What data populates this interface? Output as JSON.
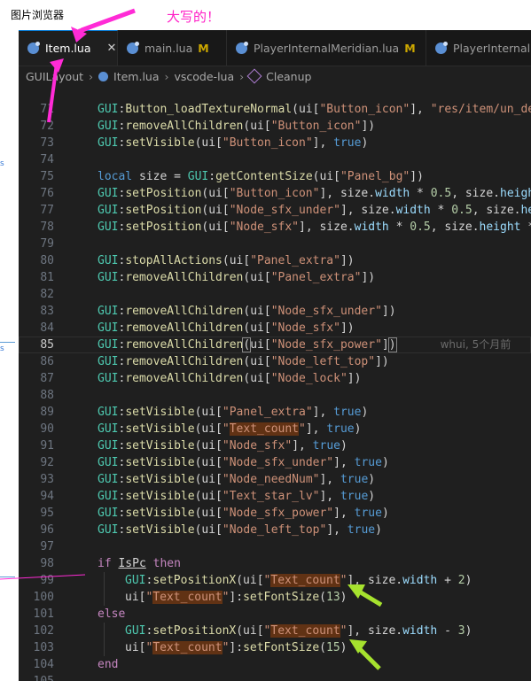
{
  "host": {
    "title": "图片浏览器",
    "note": "大写的！"
  },
  "tabs": [
    {
      "label": "Item.lua",
      "active": true,
      "modified": "",
      "close": "✕"
    },
    {
      "label": "main.lua",
      "active": false,
      "modified": "M"
    },
    {
      "label": "PlayerInternalMeridian.lua",
      "active": false,
      "modified": "M"
    },
    {
      "label": "PlayerInternalM",
      "active": false,
      "modified": ""
    }
  ],
  "breadcrumb": {
    "items": [
      "GUILayout",
      "Item.lua",
      "vscode-lua",
      "Cleanup"
    ]
  },
  "blame": "whui, 5个月前",
  "lines": [
    {
      "n": "71",
      "segs": [
        [
          "GUI",
          "glob"
        ],
        [
          ":",
          ""
        ],
        [
          "Button_loadTextureNormal",
          "fn"
        ],
        [
          "(ui[",
          ""
        ],
        [
          "\"Button_icon\"",
          "str"
        ],
        [
          "], ",
          ""
        ],
        [
          "\"res/item/un_def",
          "str"
        ]
      ]
    },
    {
      "n": "72",
      "segs": [
        [
          "GUI",
          "glob"
        ],
        [
          ":",
          ""
        ],
        [
          "removeAllChildren",
          "fn"
        ],
        [
          "(ui[",
          ""
        ],
        [
          "\"Button_icon\"",
          "str"
        ],
        [
          "])",
          ""
        ]
      ]
    },
    {
      "n": "73",
      "segs": [
        [
          "GUI",
          "glob"
        ],
        [
          ":",
          ""
        ],
        [
          "setVisible",
          "fn"
        ],
        [
          "(ui[",
          ""
        ],
        [
          "\"Button_icon\"",
          "str"
        ],
        [
          "], ",
          ""
        ],
        [
          "true",
          "kw"
        ],
        [
          ")",
          ""
        ]
      ]
    },
    {
      "n": "74",
      "segs": []
    },
    {
      "n": "75",
      "segs": [
        [
          "local ",
          "kw"
        ],
        [
          "size",
          ""
        ],
        [
          " = ",
          ""
        ],
        [
          "GUI",
          "glob"
        ],
        [
          ":",
          ""
        ],
        [
          "getContentSize",
          "fn"
        ],
        [
          "(ui[",
          ""
        ],
        [
          "\"Panel_bg\"",
          "str"
        ],
        [
          "])",
          ""
        ]
      ]
    },
    {
      "n": "76",
      "segs": [
        [
          "GUI",
          "glob"
        ],
        [
          ":",
          ""
        ],
        [
          "setPosition",
          "fn"
        ],
        [
          "(ui[",
          ""
        ],
        [
          "\"Button_icon\"",
          "str"
        ],
        [
          "], size.",
          ""
        ],
        [
          "width",
          "var"
        ],
        [
          " * ",
          ""
        ],
        [
          "0.5",
          "num"
        ],
        [
          ", size.",
          ""
        ],
        [
          "height",
          "var"
        ]
      ]
    },
    {
      "n": "77",
      "segs": [
        [
          "GUI",
          "glob"
        ],
        [
          ":",
          ""
        ],
        [
          "setPosition",
          "fn"
        ],
        [
          "(ui[",
          ""
        ],
        [
          "\"Node_sfx_under\"",
          "str"
        ],
        [
          "], size.",
          ""
        ],
        [
          "width",
          "var"
        ],
        [
          " * ",
          ""
        ],
        [
          "0.5",
          "num"
        ],
        [
          ", size.",
          ""
        ],
        [
          "hei",
          "var"
        ]
      ]
    },
    {
      "n": "78",
      "segs": [
        [
          "GUI",
          "glob"
        ],
        [
          ":",
          ""
        ],
        [
          "setPosition",
          "fn"
        ],
        [
          "(ui[",
          ""
        ],
        [
          "\"Node_sfx\"",
          "str"
        ],
        [
          "], size.",
          ""
        ],
        [
          "width",
          "var"
        ],
        [
          " * ",
          ""
        ],
        [
          "0.5",
          "num"
        ],
        [
          ", size.",
          ""
        ],
        [
          "height",
          "var"
        ],
        [
          " *",
          ""
        ]
      ]
    },
    {
      "n": "79",
      "segs": []
    },
    {
      "n": "80",
      "segs": [
        [
          "GUI",
          "glob"
        ],
        [
          ":",
          ""
        ],
        [
          "stopAllActions",
          "fn"
        ],
        [
          "(ui[",
          ""
        ],
        [
          "\"Panel_extra\"",
          "str"
        ],
        [
          "])",
          ""
        ]
      ]
    },
    {
      "n": "81",
      "segs": [
        [
          "GUI",
          "glob"
        ],
        [
          ":",
          ""
        ],
        [
          "removeAllChildren",
          "fn"
        ],
        [
          "(ui[",
          ""
        ],
        [
          "\"Panel_extra\"",
          "str"
        ],
        [
          "])",
          ""
        ]
      ]
    },
    {
      "n": "82",
      "segs": []
    },
    {
      "n": "83",
      "segs": [
        [
          "GUI",
          "glob"
        ],
        [
          ":",
          ""
        ],
        [
          "removeAllChildren",
          "fn"
        ],
        [
          "(ui[",
          ""
        ],
        [
          "\"Node_sfx_under\"",
          "str"
        ],
        [
          "])",
          ""
        ]
      ]
    },
    {
      "n": "84",
      "segs": [
        [
          "GUI",
          "glob"
        ],
        [
          ":",
          ""
        ],
        [
          "removeAllChildren",
          "fn"
        ],
        [
          "(ui[",
          ""
        ],
        [
          "\"Node_sfx\"",
          "str"
        ],
        [
          "])",
          ""
        ]
      ]
    },
    {
      "n": "85",
      "cur": true,
      "segs": [
        [
          "GUI",
          "glob"
        ],
        [
          ":",
          ""
        ],
        [
          "removeAllChildren",
          "fn"
        ],
        [
          "(",
          "bk"
        ],
        [
          "ui[",
          ""
        ],
        [
          "\"Node_sfx_power\"",
          "str"
        ],
        [
          "]",
          ""
        ],
        [
          ")",
          "bk"
        ]
      ]
    },
    {
      "n": "86",
      "segs": [
        [
          "GUI",
          "glob"
        ],
        [
          ":",
          ""
        ],
        [
          "removeAllChildren",
          "fn"
        ],
        [
          "(ui[",
          ""
        ],
        [
          "\"Node_left_top\"",
          "str"
        ],
        [
          "])",
          ""
        ]
      ]
    },
    {
      "n": "87",
      "segs": [
        [
          "GUI",
          "glob"
        ],
        [
          ":",
          ""
        ],
        [
          "removeAllChildren",
          "fn"
        ],
        [
          "(ui[",
          ""
        ],
        [
          "\"Node_lock\"",
          "str"
        ],
        [
          "])",
          ""
        ]
      ]
    },
    {
      "n": "88",
      "segs": []
    },
    {
      "n": "89",
      "segs": [
        [
          "GUI",
          "glob"
        ],
        [
          ":",
          ""
        ],
        [
          "setVisible",
          "fn"
        ],
        [
          "(ui[",
          ""
        ],
        [
          "\"Panel_extra\"",
          "str"
        ],
        [
          "], ",
          ""
        ],
        [
          "true",
          "kw"
        ],
        [
          ")",
          ""
        ]
      ]
    },
    {
      "n": "90",
      "segs": [
        [
          "GUI",
          "glob"
        ],
        [
          ":",
          ""
        ],
        [
          "setVisible",
          "fn"
        ],
        [
          "(ui[",
          ""
        ],
        [
          "\"",
          "str"
        ],
        [
          "Text_count",
          "hl"
        ],
        [
          "\"",
          "str"
        ],
        [
          "], ",
          ""
        ],
        [
          "true",
          "kw"
        ],
        [
          ")",
          ""
        ]
      ]
    },
    {
      "n": "91",
      "segs": [
        [
          "GUI",
          "glob"
        ],
        [
          ":",
          ""
        ],
        [
          "setVisible",
          "fn"
        ],
        [
          "(ui[",
          ""
        ],
        [
          "\"Node_sfx\"",
          "str"
        ],
        [
          "], ",
          ""
        ],
        [
          "true",
          "kw"
        ],
        [
          ")",
          ""
        ]
      ]
    },
    {
      "n": "92",
      "segs": [
        [
          "GUI",
          "glob"
        ],
        [
          ":",
          ""
        ],
        [
          "setVisible",
          "fn"
        ],
        [
          "(ui[",
          ""
        ],
        [
          "\"Node_sfx_under\"",
          "str"
        ],
        [
          "], ",
          ""
        ],
        [
          "true",
          "kw"
        ],
        [
          ")",
          ""
        ]
      ]
    },
    {
      "n": "93",
      "segs": [
        [
          "GUI",
          "glob"
        ],
        [
          ":",
          ""
        ],
        [
          "setVisible",
          "fn"
        ],
        [
          "(ui[",
          ""
        ],
        [
          "\"Node_needNum\"",
          "str"
        ],
        [
          "], ",
          ""
        ],
        [
          "true",
          "kw"
        ],
        [
          ")",
          ""
        ]
      ]
    },
    {
      "n": "94",
      "segs": [
        [
          "GUI",
          "glob"
        ],
        [
          ":",
          ""
        ],
        [
          "setVisible",
          "fn"
        ],
        [
          "(ui[",
          ""
        ],
        [
          "\"Text_star_lv\"",
          "str"
        ],
        [
          "], ",
          ""
        ],
        [
          "true",
          "kw"
        ],
        [
          ")",
          ""
        ]
      ]
    },
    {
      "n": "95",
      "segs": [
        [
          "GUI",
          "glob"
        ],
        [
          ":",
          ""
        ],
        [
          "setVisible",
          "fn"
        ],
        [
          "(ui[",
          ""
        ],
        [
          "\"Node_sfx_power\"",
          "str"
        ],
        [
          "], ",
          ""
        ],
        [
          "true",
          "kw"
        ],
        [
          ")",
          ""
        ]
      ]
    },
    {
      "n": "96",
      "segs": [
        [
          "GUI",
          "glob"
        ],
        [
          ":",
          ""
        ],
        [
          "setVisible",
          "fn"
        ],
        [
          "(ui[",
          ""
        ],
        [
          "\"Node_left_top\"",
          "str"
        ],
        [
          "], ",
          ""
        ],
        [
          "true",
          "kw"
        ],
        [
          ")",
          ""
        ]
      ]
    },
    {
      "n": "97",
      "segs": []
    },
    {
      "n": "98",
      "segs": [
        [
          "if ",
          "kw2"
        ],
        [
          "IsPc",
          "ul"
        ],
        [
          " then",
          "kw2"
        ]
      ]
    },
    {
      "n": "99",
      "indent": 1,
      "segs": [
        [
          "GUI",
          "glob"
        ],
        [
          ":",
          ""
        ],
        [
          "setPositionX",
          "fn"
        ],
        [
          "(ui[",
          ""
        ],
        [
          "\"",
          "str"
        ],
        [
          "Text_count",
          "hl"
        ],
        [
          "\"",
          "str"
        ],
        [
          "], size.",
          ""
        ],
        [
          "width",
          "var"
        ],
        [
          " + ",
          ""
        ],
        [
          "2",
          "num"
        ],
        [
          ")",
          ""
        ]
      ]
    },
    {
      "n": "100",
      "indent": 1,
      "segs": [
        [
          "ui[",
          ""
        ],
        [
          "\"",
          "str"
        ],
        [
          "Text_count",
          "hl"
        ],
        [
          "\"",
          "str"
        ],
        [
          "]:",
          ""
        ],
        [
          "setFontSize",
          "fn"
        ],
        [
          "(",
          ""
        ],
        [
          "13",
          "num"
        ],
        [
          ")",
          ""
        ]
      ]
    },
    {
      "n": "101",
      "segs": [
        [
          "else",
          "kw2"
        ]
      ]
    },
    {
      "n": "102",
      "indent": 1,
      "segs": [
        [
          "GUI",
          "glob"
        ],
        [
          ":",
          ""
        ],
        [
          "setPositionX",
          "fn"
        ],
        [
          "(ui[",
          ""
        ],
        [
          "\"",
          "str"
        ],
        [
          "Text_count",
          "hl"
        ],
        [
          "\"",
          "str"
        ],
        [
          "], size.",
          ""
        ],
        [
          "width",
          "var"
        ],
        [
          " - ",
          ""
        ],
        [
          "3",
          "num"
        ],
        [
          ")",
          ""
        ]
      ]
    },
    {
      "n": "103",
      "indent": 1,
      "segs": [
        [
          "ui[",
          ""
        ],
        [
          "\"",
          "str"
        ],
        [
          "Text_count",
          "hl"
        ],
        [
          "\"",
          "str"
        ],
        [
          "]:",
          ""
        ],
        [
          "setFontSize",
          "fn"
        ],
        [
          "(",
          ""
        ],
        [
          "15",
          "num"
        ],
        [
          ")",
          ""
        ]
      ]
    },
    {
      "n": "104",
      "segs": [
        [
          "end",
          "kw2"
        ]
      ]
    },
    {
      "n": "105",
      "segs": []
    }
  ]
}
